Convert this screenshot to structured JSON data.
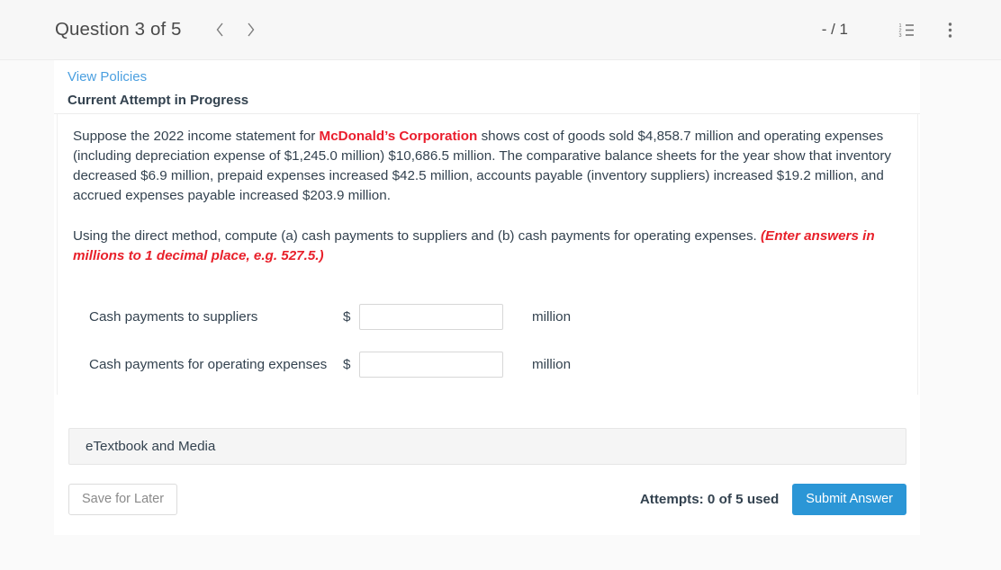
{
  "header": {
    "question_title": "Question 3 of 5",
    "prev_icon": "chevron-left-icon",
    "next_icon": "chevron-right-icon",
    "page_count": "- / 1",
    "list_icon": "numbered-list-icon",
    "more_icon": "more-vertical-icon"
  },
  "card": {
    "view_policies": "View Policies",
    "attempt_status": "Current Attempt in Progress"
  },
  "question": {
    "paragraph1_pre": "Suppose the 2022 income statement for ",
    "company": "McDonald’s Corporation",
    "paragraph1_post": " shows cost of goods sold $4,858.7 million and operating expenses (including depreciation expense of $1,245.0 million) $10,686.5 million. The comparative balance sheets for the year show that inventory decreased $6.9 million, prepaid expenses increased $42.5 million, accounts payable (inventory suppliers) increased $19.2 million, and accrued expenses payable increased $203.9 million.",
    "paragraph2_pre": "Using the direct method, compute (a) cash payments to suppliers and (b) cash payments for operating expenses. ",
    "paragraph2_hint": "(Enter answers in millions to 1 decimal place, e.g. 527.5.)"
  },
  "answers": [
    {
      "label": "Cash payments to suppliers",
      "currency": "$",
      "value": "",
      "unit": "million"
    },
    {
      "label": "Cash payments for operating expenses",
      "currency": "$",
      "value": "",
      "unit": "million"
    }
  ],
  "footer": {
    "etextbook_label": "eTextbook and Media",
    "save_label": "Save for Later",
    "attempts_label": "Attempts: 0 of 5 used",
    "submit_label": "Submit Answer"
  },
  "colors": {
    "accent_blue": "#2b96d6",
    "link_blue": "#4a9fe0",
    "brand_red": "#ea1d2c",
    "hint_red": "#e8202a",
    "text": "#33424f",
    "page_bg": "#fafafa",
    "header_bg": "#f7f7f7"
  }
}
